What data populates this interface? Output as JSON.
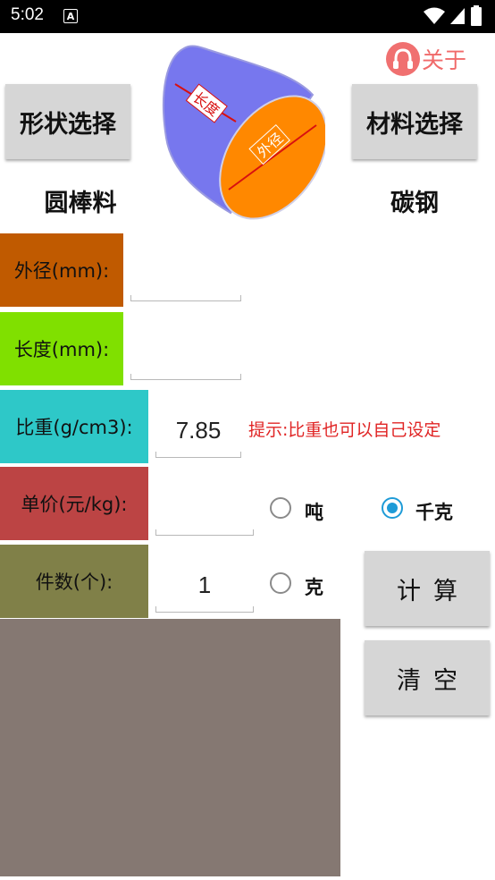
{
  "status_bar": {
    "time": "5:02",
    "notification_icon": "A"
  },
  "header": {
    "about_label": "关于"
  },
  "shape": {
    "button_label": "形状选择",
    "selected": "圆棒料"
  },
  "material": {
    "button_label": "材料选择",
    "selected": "碳钢"
  },
  "diagram": {
    "length_label": "长度",
    "diameter_label": "外径"
  },
  "form": {
    "outer_diameter": {
      "label": "外径(mm):",
      "value": "",
      "color": "#c05a00"
    },
    "length": {
      "label": "长度(mm):",
      "value": "",
      "color": "#80e000"
    },
    "density": {
      "label": "比重(g/cm3):",
      "value": "7.85",
      "color": "#2ec8c8"
    },
    "unit_price": {
      "label": "单价(元/kg):",
      "value": "",
      "color": "#bc4444"
    },
    "quantity": {
      "label": "件数(个):",
      "value": "1",
      "color": "#808048"
    }
  },
  "hint": "提示:比重也可以自己设定",
  "units": {
    "ton": {
      "label": "吨",
      "selected": false
    },
    "kilogram": {
      "label": "千克",
      "selected": true
    },
    "gram": {
      "label": "克",
      "selected": false
    }
  },
  "actions": {
    "calculate_label": "计算",
    "clear_label": "清空"
  },
  "result_area": {
    "color": "#857872"
  }
}
